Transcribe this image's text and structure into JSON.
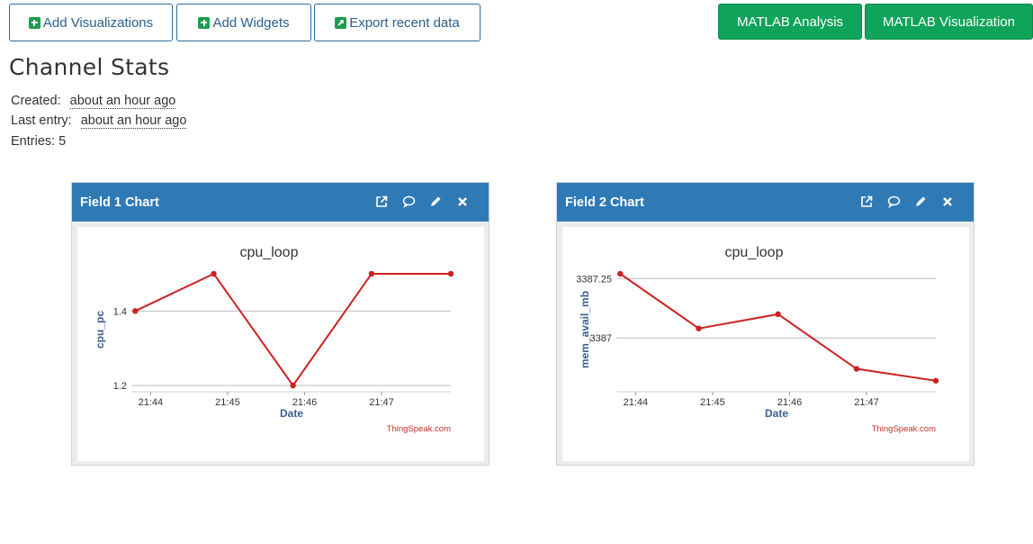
{
  "toolbar": {
    "add_visualizations": "Add Visualizations",
    "add_widgets": "Add Widgets",
    "export_recent": "Export recent data",
    "matlab_analysis": "MATLAB Analysis",
    "matlab_visualization": "MATLAB Visualization"
  },
  "stats": {
    "title": "Channel Stats",
    "created_label": "Created:",
    "created_value": "about an hour ago",
    "last_entry_label": "Last entry:",
    "last_entry_value": "about an hour ago",
    "entries_text": "Entries: 5"
  },
  "panels": [
    {
      "title": "Field 1 Chart",
      "icons": [
        "external-link-icon",
        "comment-icon",
        "pencil-icon",
        "close-icon"
      ]
    },
    {
      "title": "Field 2 Chart",
      "icons": [
        "external-link-icon",
        "comment-icon",
        "pencil-icon",
        "close-icon"
      ]
    }
  ],
  "colors": {
    "panel_header": "#2f7ab5",
    "green_button": "#10a35a",
    "line": "#cc2222",
    "axis_label": "#3a5f8f"
  },
  "chart_data": [
    {
      "type": "line",
      "title": "cpu_loop",
      "xlabel": "Date",
      "ylabel": "cpu_pc",
      "credit": "ThingSpeak.com",
      "x_ticks": [
        "21:44",
        "21:45",
        "21:46",
        "21:47"
      ],
      "x_tick_minutes": [
        44,
        45,
        46,
        47
      ],
      "xlim_minutes": [
        43.75,
        47.9
      ],
      "x_minutes": [
        43.8,
        44.82,
        45.85,
        46.87,
        47.9
      ],
      "y_ticks": [
        1.2,
        1.4
      ],
      "ylim": [
        1.2,
        1.5
      ],
      "y": [
        1.4,
        1.5,
        1.2,
        1.5,
        1.5
      ],
      "grid": true
    },
    {
      "type": "line",
      "title": "cpu_loop",
      "xlabel": "Date",
      "ylabel": "mem_avail_mb",
      "credit": "ThingSpeak.com",
      "x_ticks": [
        "21:44",
        "21:45",
        "21:46",
        "21:47"
      ],
      "x_tick_minutes": [
        44,
        45,
        46,
        47
      ],
      "xlim_minutes": [
        43.75,
        47.9
      ],
      "x_minutes": [
        43.8,
        44.82,
        45.85,
        46.87,
        47.9
      ],
      "y_ticks": [
        3387,
        3387.25
      ],
      "ylim": [
        3386.8,
        3387.27
      ],
      "y": [
        3387.27,
        3387.04,
        3387.1,
        3386.87,
        3386.82
      ],
      "grid": true
    }
  ]
}
